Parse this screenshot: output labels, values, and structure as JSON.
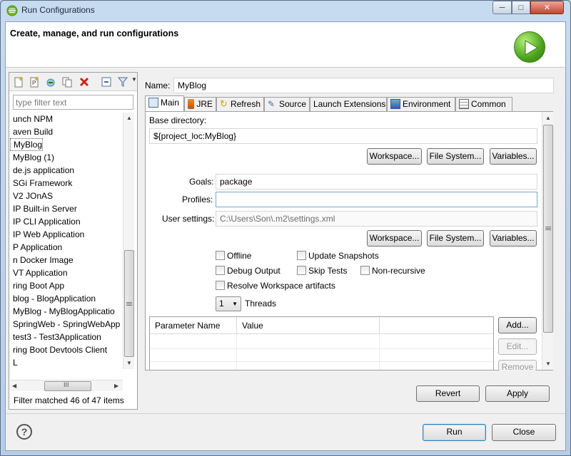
{
  "window": {
    "title": "Run Configurations"
  },
  "header": {
    "title": "Create, manage, and run configurations"
  },
  "left": {
    "filter_placeholder": "type filter text",
    "tree_items": [
      "unch NPM",
      "aven Build",
      "MyBlog",
      "MyBlog (1)",
      "de.js application",
      "SGi Framework",
      "V2 JOnAS",
      "IP Built-in Server",
      "IP CLI Application",
      "IP Web Application",
      "P Application",
      "n Docker Image",
      "VT Application",
      "ring Boot App",
      "blog - BlogApplication",
      "MyBlog - MyBlogApplicatio",
      "SpringWeb - SpringWebApp",
      "test3 - Test3Application",
      "ring Boot Devtools Client",
      "L"
    ],
    "hscroll_glyph": "III",
    "filter_status": "Filter matched 46 of 47 items"
  },
  "config": {
    "name_label": "Name:",
    "name_value": "MyBlog",
    "tabs": [
      "Main",
      "JRE",
      "Refresh",
      "Source",
      "Launch Extensions",
      "Environment",
      "Common"
    ],
    "base_dir_label": "Base directory:",
    "base_dir_value": "${project_loc:MyBlog}",
    "buttons1": [
      "Workspace...",
      "File System...",
      "Variables..."
    ],
    "goals_label": "Goals:",
    "goals_value": "package",
    "profiles_label": "Profiles:",
    "profiles_value": "",
    "user_settings_label": "User settings:",
    "user_settings_value": "C:\\Users\\Son\\.m2\\settings.xml",
    "buttons2": [
      "Workspace...",
      "File System...",
      "Variables..."
    ],
    "checkboxes": {
      "offline": "Offline",
      "update_snapshots": "Update Snapshots",
      "debug_output": "Debug Output",
      "skip_tests": "Skip Tests",
      "non_recursive": "Non-recursive",
      "resolve_workspace": "Resolve Workspace artifacts"
    },
    "threads_value": "1",
    "threads_label": "Threads",
    "table_headers": [
      "Parameter Name",
      "Value"
    ],
    "table_buttons": [
      "Add...",
      "Edit...",
      "Remove"
    ],
    "revert": "Revert",
    "apply": "Apply"
  },
  "footer": {
    "run": "Run",
    "close": "Close"
  },
  "icons": {
    "titlebar": "eclipse-icon",
    "logo": "run-play-icon",
    "help": "help-icon"
  },
  "colors": {
    "accent_green": "#4ba21c",
    "close_red": "#c7442f"
  }
}
